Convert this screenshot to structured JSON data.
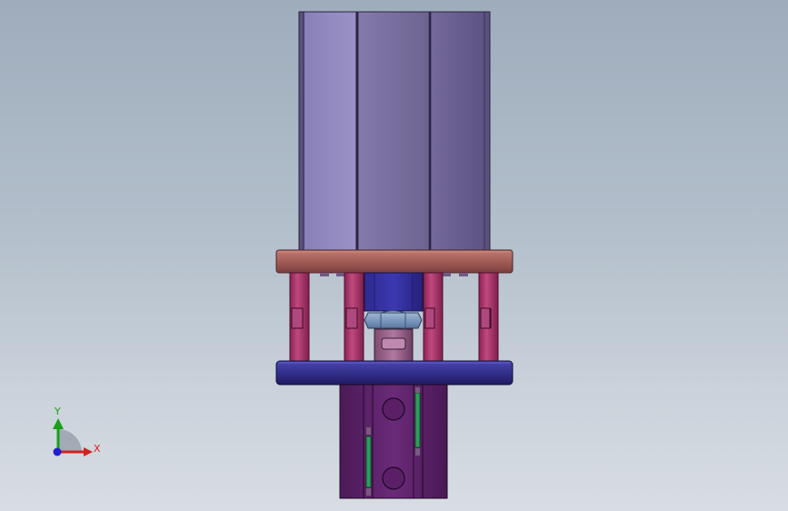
{
  "viewport": {
    "background_top": "#9eacbc",
    "background_bottom": "#d8dde3"
  },
  "colors": {
    "cylinder_body": "#7a6f9f",
    "top_plate": "#a3635e",
    "guide_posts": "#a8356d",
    "bottom_plate": "#33308c",
    "nut": "#6f8fb8",
    "lower_housing": "#5a1f66",
    "green_strip": "#2aa05a"
  },
  "triad": {
    "x_label": "X",
    "y_label": "Y",
    "x_color": "#d42020",
    "y_color": "#1aa01a",
    "z_color": "#2020d0"
  }
}
